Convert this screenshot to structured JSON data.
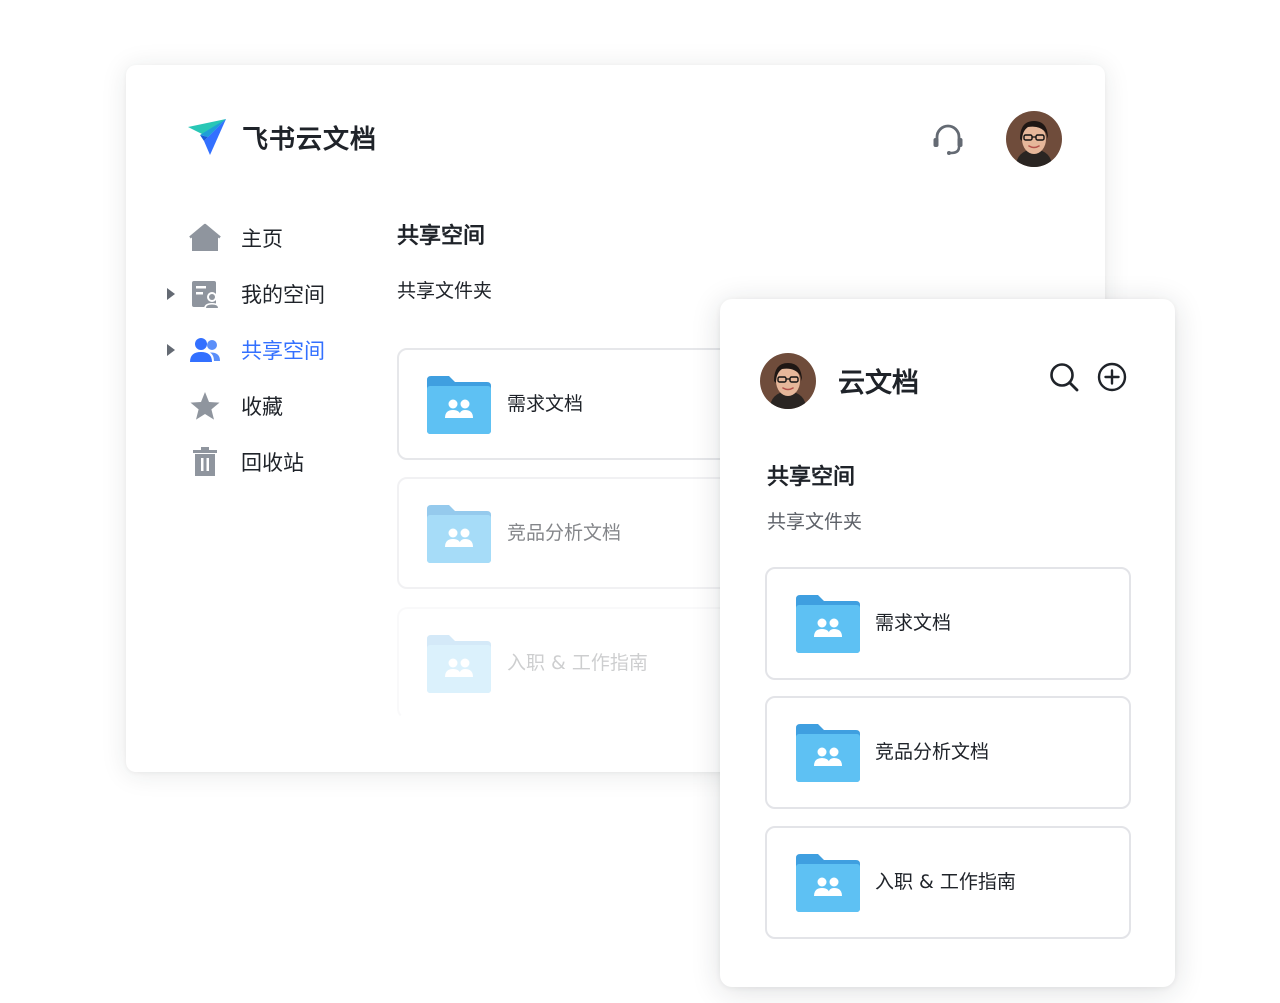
{
  "app": {
    "name": "飞书云文档"
  },
  "icons": {
    "logo": "feishu-paper-plane-icon",
    "headset": "headset-icon",
    "home": "home-icon",
    "my_space": "my-space-icon",
    "shared": "shared-users-icon",
    "favorites": "star-icon",
    "trash": "trash-icon",
    "folder": "shared-folder-icon",
    "search": "search-icon",
    "add": "add-circle-icon"
  },
  "colors": {
    "accent": "#3370ff",
    "folder": "#5ec1f3",
    "text": "#1f2329",
    "muted": "#8f959e"
  },
  "sidebar": {
    "items": [
      {
        "label": "主页",
        "icon": "home-icon"
      },
      {
        "label": "我的空间",
        "icon": "my-space-icon"
      },
      {
        "label": "共享空间",
        "icon": "shared-users-icon",
        "active": true
      },
      {
        "label": "收藏",
        "icon": "star-icon"
      },
      {
        "label": "回收站",
        "icon": "trash-icon"
      }
    ]
  },
  "main": {
    "title": "共享空间",
    "subtitle": "共享文件夹",
    "folders": [
      {
        "name": "需求文档"
      },
      {
        "name": "竞品分析文档"
      },
      {
        "name": "入职 & 工作指南"
      }
    ]
  },
  "mobile": {
    "title": "云文档",
    "section_title": "共享空间",
    "section_subtitle": "共享文件夹",
    "folders": [
      {
        "name": "需求文档"
      },
      {
        "name": "竞品分析文档"
      },
      {
        "name": "入职 & 工作指南"
      }
    ]
  }
}
